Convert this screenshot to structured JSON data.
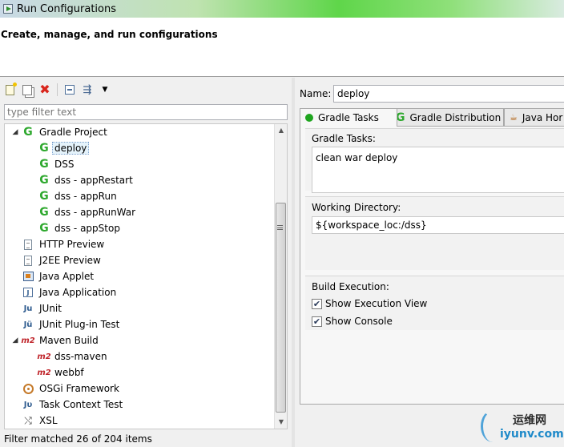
{
  "window": {
    "title": "Run Configurations"
  },
  "banner": {
    "heading": "Create, manage, and run configurations"
  },
  "left": {
    "filter_placeholder": "type filter text",
    "tree": [
      {
        "level": 0,
        "twisty": "◢",
        "icon": "gradle-icon",
        "label": "Gradle Project"
      },
      {
        "level": 1,
        "icon": "gradle-icon",
        "label": "deploy",
        "selected": true
      },
      {
        "level": 1,
        "icon": "gradle-icon",
        "label": "DSS"
      },
      {
        "level": 1,
        "icon": "gradle-icon",
        "label": "dss - appRestart"
      },
      {
        "level": 1,
        "icon": "gradle-icon",
        "label": "dss - appRun"
      },
      {
        "level": 1,
        "icon": "gradle-icon",
        "label": "dss - appRunWar"
      },
      {
        "level": 1,
        "icon": "gradle-icon",
        "label": "dss - appStop"
      },
      {
        "level": 0,
        "icon": "page-icon",
        "label": "HTTP Preview"
      },
      {
        "level": 0,
        "icon": "page-icon",
        "label": "J2EE Preview"
      },
      {
        "level": 0,
        "icon": "applet-icon",
        "label": "Java Applet"
      },
      {
        "level": 0,
        "icon": "java-app-icon",
        "label": "Java Application"
      },
      {
        "level": 0,
        "icon": "junit-icon",
        "label": "JUnit"
      },
      {
        "level": 0,
        "icon": "junit-plugin-icon",
        "label": "JUnit Plug-in Test"
      },
      {
        "level": 0,
        "twisty": "◢",
        "icon": "maven-icon",
        "label": "Maven Build"
      },
      {
        "level": 1,
        "icon": "maven-icon",
        "label": "dss-maven"
      },
      {
        "level": 1,
        "icon": "maven-icon",
        "label": "webbf"
      },
      {
        "level": 0,
        "icon": "osgi-icon",
        "label": "OSGi Framework"
      },
      {
        "level": 0,
        "icon": "task-context-icon",
        "label": "Task Context Test"
      },
      {
        "level": 0,
        "icon": "xsl-icon",
        "label": "XSL"
      }
    ],
    "status": "Filter matched 26 of 204 items"
  },
  "right": {
    "name_label": "Name:",
    "name_value": "deploy",
    "tabs": [
      {
        "label": "Gradle Tasks",
        "icon": "green-dot-icon",
        "active": true
      },
      {
        "label": "Gradle Distribution",
        "icon": "gradle-icon"
      },
      {
        "label": "Java Hor",
        "icon": "java-icon"
      }
    ],
    "gradle_tasks_label": "Gradle Tasks:",
    "gradle_tasks_value": "clean war deploy",
    "working_dir_label": "Working Directory:",
    "working_dir_value": "${workspace_loc:/dss}",
    "build_execution_label": "Build Execution:",
    "show_execution_view_label": "Show Execution View",
    "show_execution_view": true,
    "show_console_label": "Show Console",
    "show_console": true
  },
  "watermark": {
    "brand_cn": "运维网",
    "url": "iyunv.com"
  },
  "colors": {
    "gradle_green": "#2ea82e",
    "maven_red": "#c0262c",
    "selection": "#e5f3fb"
  }
}
